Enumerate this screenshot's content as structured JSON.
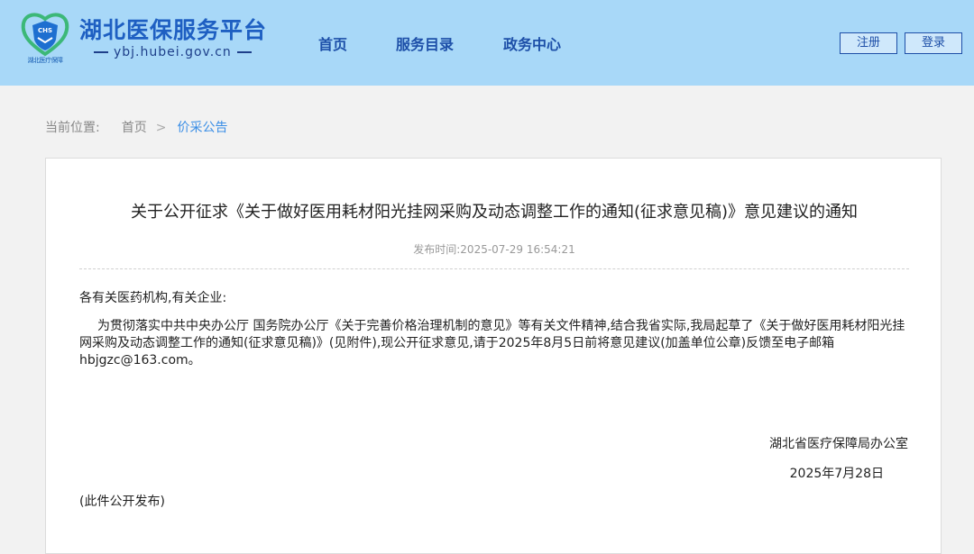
{
  "header": {
    "logo_emblem_text": "CHS",
    "logo_sub_text": "湖北医疗保障",
    "title": "湖北医保服务平台",
    "url": "ybj.hubei.gov.cn",
    "nav": [
      "首页",
      "服务目录",
      "政务中心"
    ],
    "register_label": "注册",
    "login_label": "登录",
    "colors": {
      "header_bg": "#a8d8f8",
      "brand_blue": "#1e5fc2",
      "logo_green": "#3cb878"
    }
  },
  "breadcrumb": {
    "prefix": "当前位置:",
    "home": "首页",
    "separator": ">",
    "current": "价采公告"
  },
  "article": {
    "title": "关于公开征求《关于做好医用耗材阳光挂网采购及动态调整工作的通知(征求意见稿)》意见建议的通知",
    "publish_time": "发布时间:2025-07-29 16:54:21",
    "salutation": "各有关医药机构,有关企业:",
    "paragraph": "为贯彻落实中共中央办公厅 国务院办公厅《关于完善价格治理机制的意见》等有关文件精神,结合我省实际,我局起草了《关于做好医用耗材阳光挂网采购及动态调整工作的通知(征求意见稿)》(见附件),现公开征求意见,请于2025年8月5日前将意见建议(加盖单位公章)反馈至电子邮箱hbjgzc@163.com。",
    "signature_org": "湖北省医疗保障局办公室",
    "signature_date": "2025年7月28日",
    "footnote": "(此件公开发布)"
  }
}
